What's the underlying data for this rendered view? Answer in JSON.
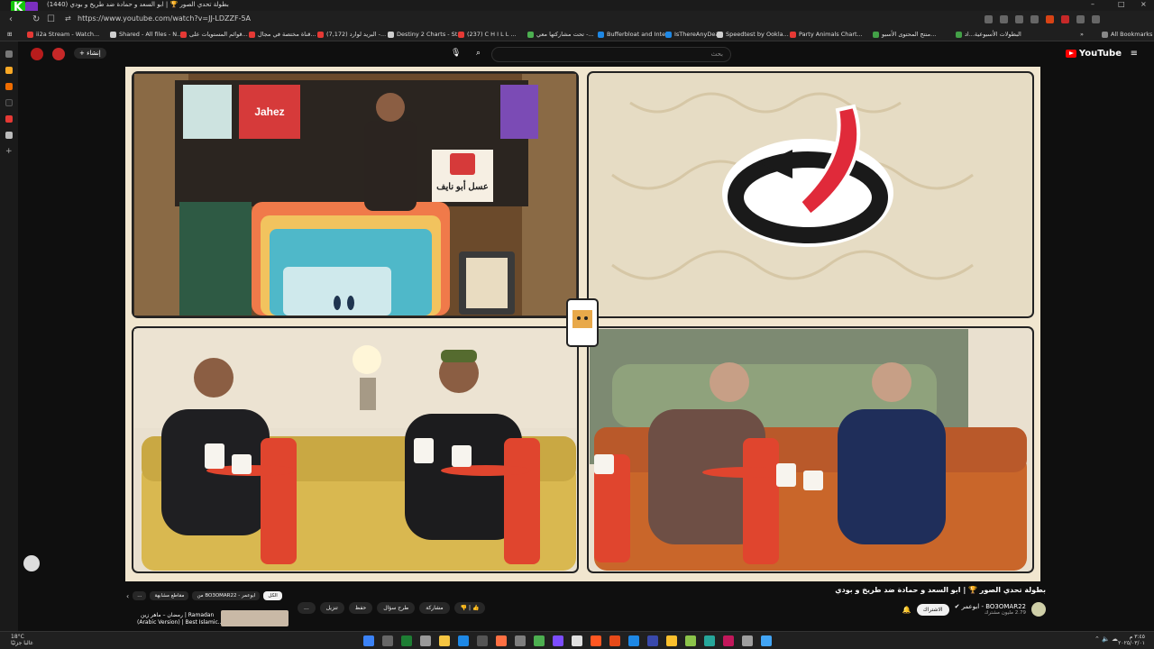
{
  "browser": {
    "tab_title": "(1440) بطولة تحدي الصور 🏆 | ابو السعد و حمادة ضد طريخ و بودي",
    "url": "https://www.youtube.com/watch?v=JJ-LDZZF-5A",
    "window_controls": [
      "–",
      "□",
      "×"
    ],
    "bookmarks": [
      {
        "label": "ii2a Stream - Watch...",
        "color": "#e53935"
      },
      {
        "label": "Shared - All files - N...",
        "color": "#cfcfcf"
      },
      {
        "label": "قوائم المستويات على...",
        "color": "#e53935"
      },
      {
        "label": "قناة مختصة في مجال...",
        "color": "#e53935"
      },
      {
        "label": "(7,172) البريد لوارد -...",
        "color": "#e53935"
      },
      {
        "label": "Destiny 2 Charts - St...",
        "color": "#cfcfcf"
      },
      {
        "label": "(237) C H I L L ...",
        "color": "#e53935"
      },
      {
        "label": "تحت مشاركتها معي -...",
        "color": "#4caf50"
      },
      {
        "label": "Bufferbloat and Inte...",
        "color": "#1e88e5"
      },
      {
        "label": "IsThereAnyDeal",
        "color": "#1e88e5"
      },
      {
        "label": "Speedtest by Ookla...",
        "color": "#cfcfcf"
      },
      {
        "label": "Party Animals Chart...",
        "color": "#e53935"
      },
      {
        "label": "منتج المحتوى الأسبو...",
        "color": "#43a047"
      },
      {
        "label": "البطولات الأسبوعية...اد",
        "color": "#43a047"
      }
    ],
    "all_bookmarks": "All Bookmarks"
  },
  "youtube": {
    "logo_text": "YouTube",
    "create_label": "إنشاء",
    "search_placeholder": "بحث",
    "video_title": "بطولة تحدي الصور 🏆 | ابو السعد و حمادة ضد طريخ و بودي",
    "channel_name": "BO3OMAR22 - ابوعمر ✔",
    "channel_subs": "2.79 مليون مشترك",
    "subscribe_label": "الاشتراك",
    "actions": [
      "👍 ",
      "👎",
      "مشاركة",
      "طرح سؤال",
      "حفظ",
      "تنزيل",
      "..."
    ],
    "chips": [
      "الكل",
      "من BO3OMAR22 - ابوعمر",
      "مقاطع مشابهة",
      "..."
    ],
    "up_next": {
      "line1": "رمضان – ماهر زين | Ramadan",
      "line2": "(Arabic Version) | Best Islamic..."
    }
  },
  "taskbar": {
    "weather_temp": "18°C",
    "weather_desc": "غالبا جزئيًا",
    "time": "٣:٤٥ م",
    "date": "٢٠٢٥/٠٣/٠١"
  },
  "video_signs": {
    "brand_sign": "Jahez",
    "shelf_sign": "عسل أبو نايف"
  },
  "colors": {
    "accent_red": "#e02a3a",
    "video_bg": "#f3ead8",
    "couch_yellow": "#d9b850",
    "couch_orange": "#c9662a"
  }
}
